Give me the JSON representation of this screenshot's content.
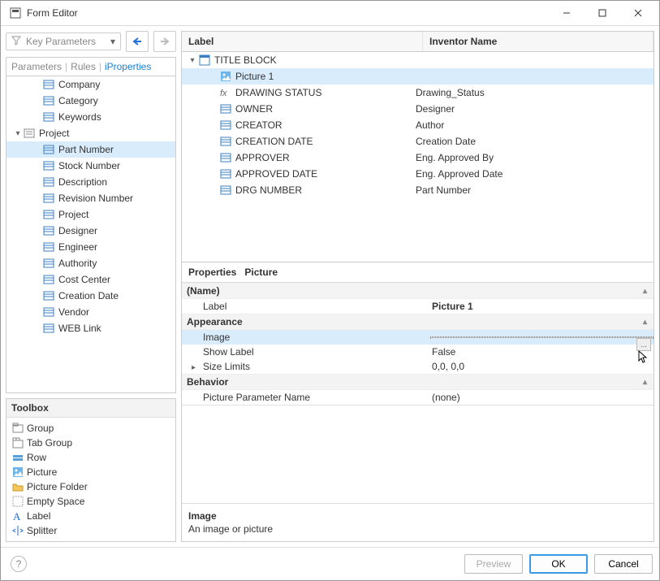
{
  "window": {
    "title": "Form Editor"
  },
  "toolbar": {
    "key_params_label": "Key Parameters"
  },
  "tabs": {
    "parameters": "Parameters",
    "rules": "Rules",
    "iproperties": "iProperties"
  },
  "left_tree": {
    "section1": [
      "Company",
      "Category",
      "Keywords"
    ],
    "project_label": "Project",
    "project_children": [
      "Part Number",
      "Stock Number",
      "Description",
      "Revision Number",
      "Project",
      "Designer",
      "Engineer",
      "Authority",
      "Cost Center",
      "Creation Date",
      "Vendor",
      "WEB Link"
    ],
    "selected_index": 0
  },
  "toolbox": {
    "header": "Toolbox",
    "items": [
      "Group",
      "Tab Group",
      "Row",
      "Picture",
      "Picture Folder",
      "Empty Space",
      "Label",
      "Splitter"
    ]
  },
  "grid": {
    "col_label": "Label",
    "col_invname": "Inventor Name",
    "root": "TITLE BLOCK",
    "rows": [
      {
        "label": "Picture 1",
        "invname": "",
        "icon": "pic",
        "selected": true
      },
      {
        "label": "DRAWING STATUS",
        "invname": "Drawing_Status",
        "icon": "fx"
      },
      {
        "label": "OWNER",
        "invname": "Designer",
        "icon": "prop"
      },
      {
        "label": "CREATOR",
        "invname": "Author",
        "icon": "prop"
      },
      {
        "label": "CREATION DATE",
        "invname": "Creation Date",
        "icon": "prop"
      },
      {
        "label": "APPROVER",
        "invname": "Eng. Approved By",
        "icon": "prop"
      },
      {
        "label": "APPROVED DATE",
        "invname": "Eng. Approved Date",
        "icon": "prop"
      },
      {
        "label": "DRG NUMBER",
        "invname": "Part Number",
        "icon": "prop"
      }
    ]
  },
  "props": {
    "title_prefix": "Properties",
    "title_context": "Picture",
    "cat_name": "(Name)",
    "label_name": "Label",
    "label_value": "Picture 1",
    "cat_appearance": "Appearance",
    "image_name": "Image",
    "image_value": "",
    "show_label_name": "Show Label",
    "show_label_value": "False",
    "size_limits_name": "Size Limits",
    "size_limits_value": "0,0, 0,0",
    "cat_behavior": "Behavior",
    "ppn_name": "Picture Parameter Name",
    "ppn_value": "(none)",
    "desc_title": "Image",
    "desc_text": "An image or picture"
  },
  "footer": {
    "preview": "Preview",
    "ok": "OK",
    "cancel": "Cancel"
  }
}
